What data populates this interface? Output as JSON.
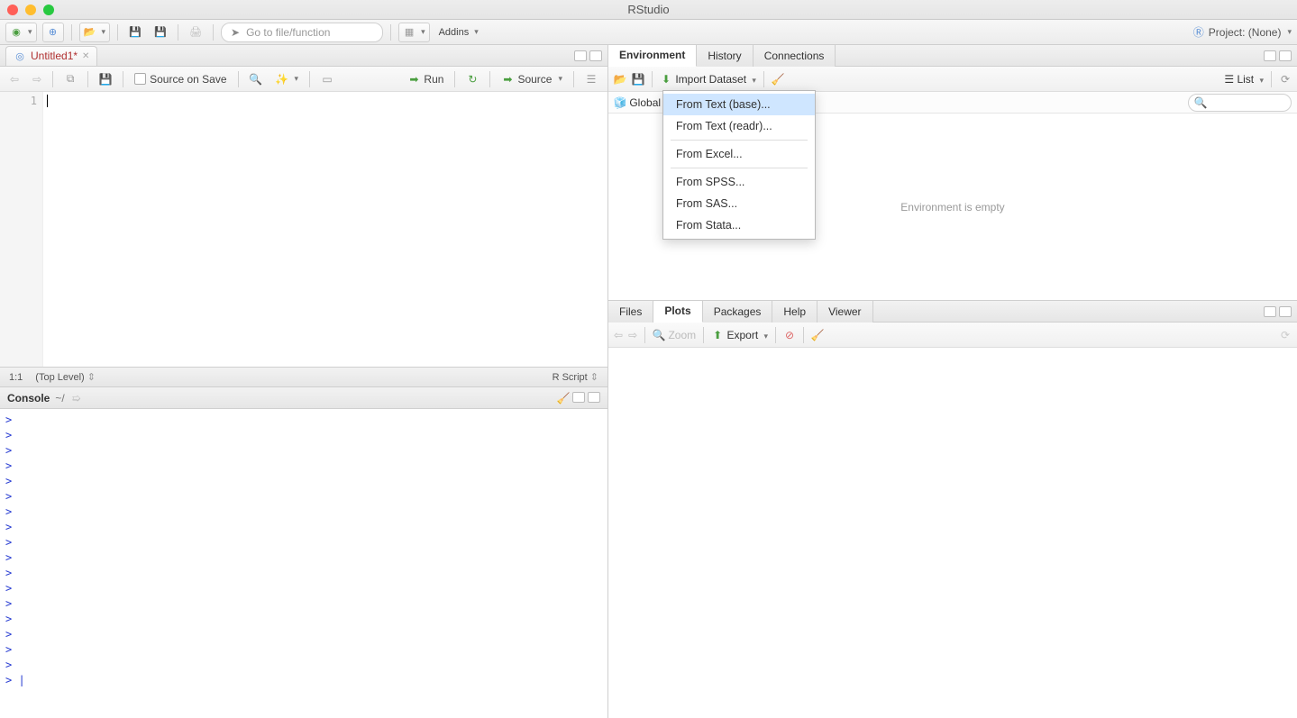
{
  "titlebar": {
    "title": "RStudio"
  },
  "maintoolbar": {
    "goto_placeholder": "Go to file/function",
    "addins": "Addins",
    "project_label": "Project: (None)"
  },
  "source_pane": {
    "tab_label": "Untitled1*",
    "source_on_save": "Source on Save",
    "run": "Run",
    "source_btn": "Source",
    "line_number": "1",
    "status_pos": "1:1",
    "status_scope": "(Top Level)",
    "status_type": "R Script"
  },
  "console": {
    "title": "Console",
    "path": "~/",
    "prompts": [
      ">",
      ">",
      ">",
      ">",
      ">",
      ">",
      ">",
      ">",
      ">",
      ">",
      ">",
      ">",
      ">",
      ">",
      ">",
      ">",
      ">",
      ">"
    ]
  },
  "env_pane": {
    "tabs": {
      "environment": "Environment",
      "history": "History",
      "connections": "Connections"
    },
    "import_label": "Import Dataset",
    "list_label": "List",
    "scope_label": "Global",
    "empty_msg": "Environment is empty",
    "dropdown": {
      "from_text_base": "From Text (base)...",
      "from_text_readr": "From Text (readr)...",
      "from_excel": "From Excel...",
      "from_spss": "From SPSS...",
      "from_sas": "From SAS...",
      "from_stata": "From Stata..."
    }
  },
  "plots_pane": {
    "tabs": {
      "files": "Files",
      "plots": "Plots",
      "packages": "Packages",
      "help": "Help",
      "viewer": "Viewer"
    },
    "zoom": "Zoom",
    "export": "Export"
  }
}
